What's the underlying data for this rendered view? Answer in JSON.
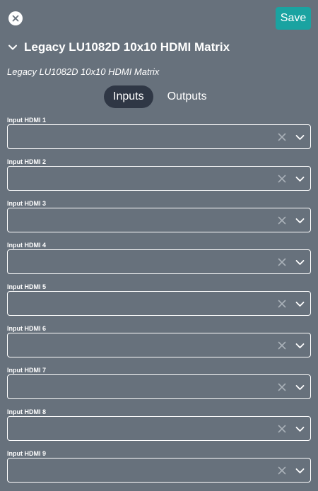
{
  "header": {
    "save_label": "Save",
    "device_title": "Legacy LU1082D 10x10 HDMI Matrix",
    "subtitle": "Legacy LU1082D 10x10 HDMI Matrix"
  },
  "tabs": [
    {
      "label": "Inputs",
      "active": true
    },
    {
      "label": "Outputs",
      "active": false
    }
  ],
  "fields": [
    {
      "label": "Input HDMI 1",
      "value": ""
    },
    {
      "label": "Input HDMI 2",
      "value": ""
    },
    {
      "label": "Input HDMI 3",
      "value": ""
    },
    {
      "label": "Input HDMI 4",
      "value": ""
    },
    {
      "label": "Input HDMI 5",
      "value": ""
    },
    {
      "label": "Input HDMI 6",
      "value": ""
    },
    {
      "label": "Input HDMI 7",
      "value": ""
    },
    {
      "label": "Input HDMI 8",
      "value": ""
    },
    {
      "label": "Input HDMI 9",
      "value": ""
    }
  ],
  "icons": {
    "close": "close-icon",
    "collapse": "chevron-down-icon",
    "clear": "clear-icon",
    "dropdown": "chevron-down-icon"
  },
  "colors": {
    "background": "#67717c",
    "accent": "#1aa3a1",
    "active_tab": "#2f3745",
    "clear_icon": "#a9b0b8"
  }
}
